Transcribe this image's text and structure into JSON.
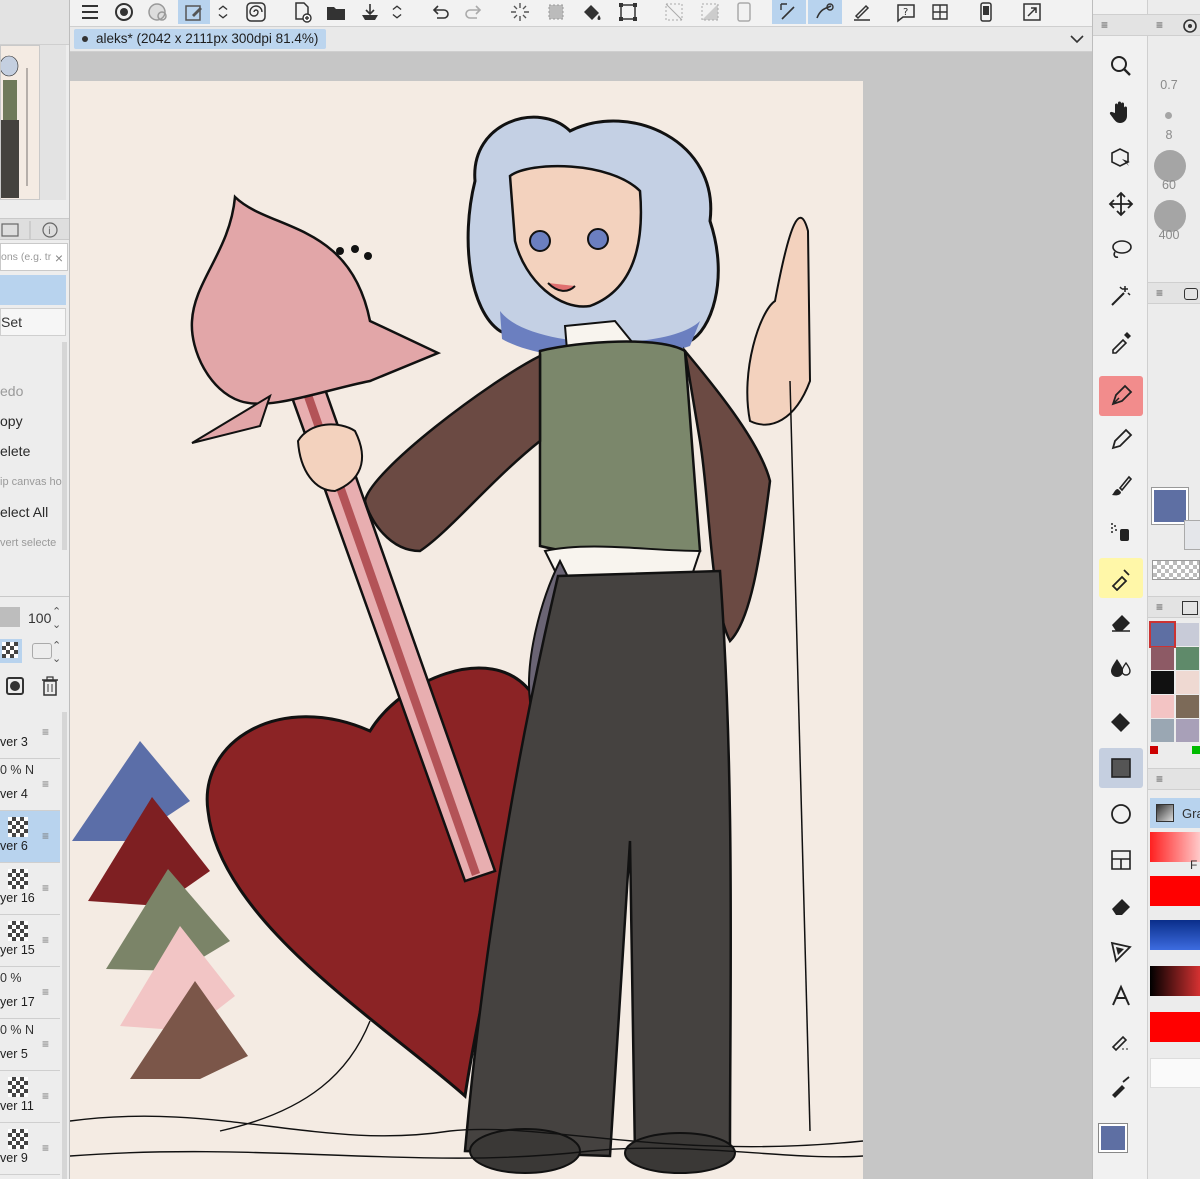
{
  "document_tab": {
    "title": "aleks* (2042 x 2111px 300dpi 81.4%)"
  },
  "command_panel": {
    "search_placeholder": "ons (e.g. tr",
    "set_label": "Set",
    "items": [
      {
        "label": "edo",
        "state": "disabled"
      },
      {
        "label": "opy",
        "state": "enabled"
      },
      {
        "label": "elete",
        "state": "enabled"
      },
      {
        "label": "ip canvas ho",
        "state": "disabled-small"
      },
      {
        "label": "elect All",
        "state": "enabled"
      },
      {
        "label": "vert selecte",
        "state": "disabled-small"
      }
    ]
  },
  "layer_panel": {
    "opacity": "100",
    "layers": [
      {
        "pct": "",
        "name": "ver 3",
        "thumb": false,
        "selected": false
      },
      {
        "pct": "0 % N",
        "name": "ver 4",
        "thumb": false,
        "selected": false
      },
      {
        "pct": "",
        "name": "ver 6",
        "thumb": true,
        "selected": true
      },
      {
        "pct": "",
        "name": "yer 16",
        "thumb": true,
        "selected": false
      },
      {
        "pct": "",
        "name": "yer 15",
        "thumb": true,
        "selected": false
      },
      {
        "pct": "0 %",
        "name": "yer 17",
        "thumb": false,
        "selected": false
      },
      {
        "pct": "0 % N",
        "name": "ver 5",
        "thumb": false,
        "selected": false
      },
      {
        "pct": "",
        "name": "ver 11",
        "thumb": true,
        "selected": false
      },
      {
        "pct": "",
        "name": "ver 9",
        "thumb": true,
        "selected": false
      },
      {
        "pct": "",
        "name": "",
        "thumb": true,
        "selected": false
      }
    ]
  },
  "brush_sizes": [
    "0.7",
    "8",
    "60",
    "400"
  ],
  "colors": {
    "main_color": "#5e6fa3",
    "sub_color": "#d7dbe4",
    "palette": [
      "#5e6fa3",
      "#c8cbd8",
      "#8d5a65",
      "#5f8a6a",
      "#111111",
      "#efd9d2",
      "#f3c4c4",
      "#7c6a58",
      "#9aa7b3",
      "#a8a0b8"
    ]
  },
  "gradient_panel": {
    "label": "Gra",
    "fill_label": "F"
  }
}
